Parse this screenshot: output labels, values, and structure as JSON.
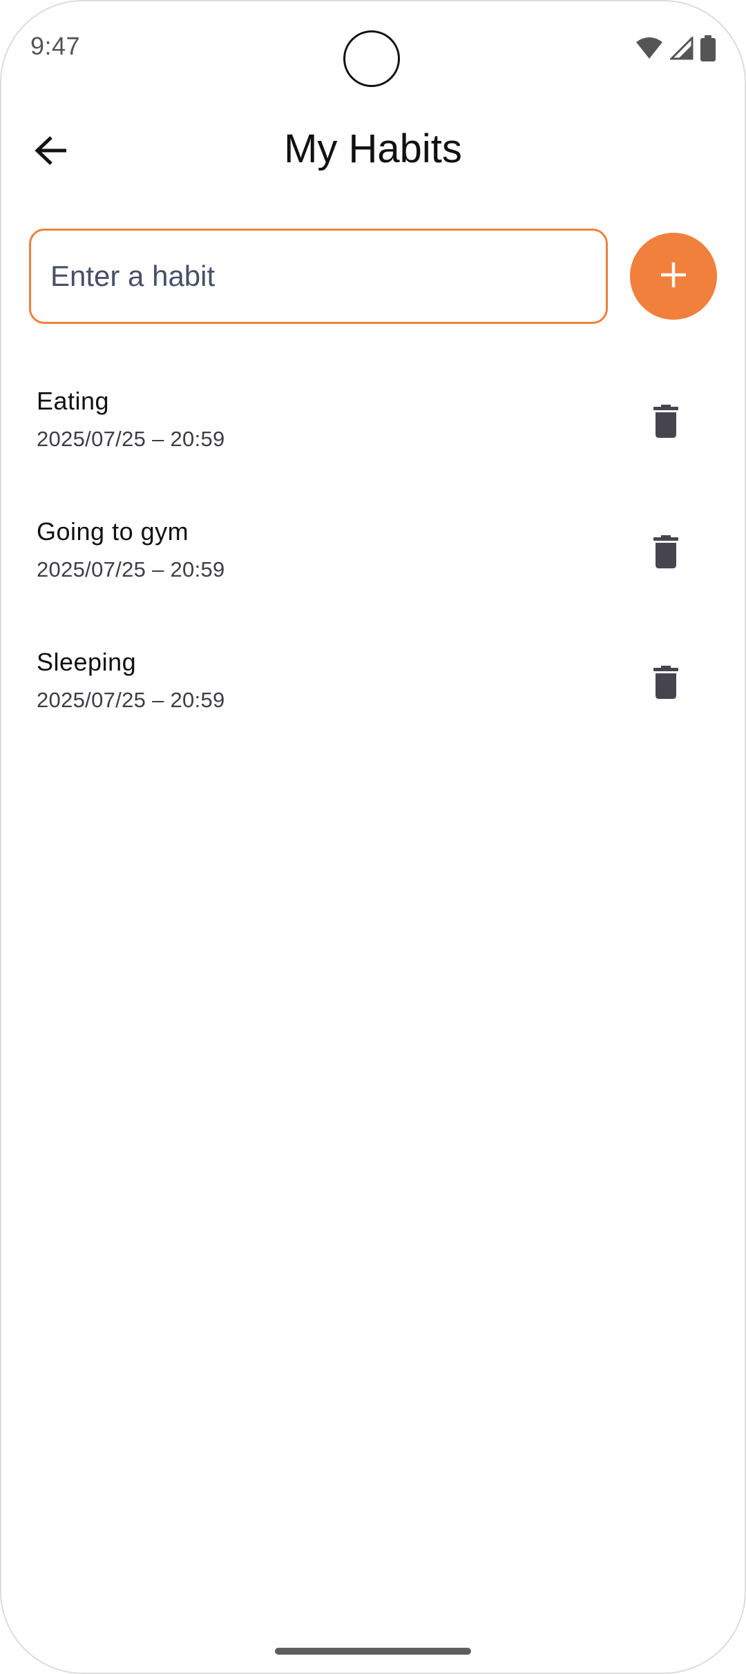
{
  "status_bar": {
    "time": "9:47",
    "icons": [
      "wifi-icon",
      "cellular-signal-icon",
      "battery-icon"
    ]
  },
  "app_bar": {
    "title": "My Habits",
    "back_icon": "arrow-back-icon"
  },
  "habit_input": {
    "placeholder": "Enter a habit",
    "value": ""
  },
  "add_button": {
    "icon": "plus-icon"
  },
  "habits": [
    {
      "name": "Eating",
      "date": "2025/07/25 – 20:59"
    },
    {
      "name": "Going to gym",
      "date": "2025/07/25 – 20:59"
    },
    {
      "name": "Sleeping",
      "date": "2025/07/25 – 20:59"
    }
  ],
  "colors": {
    "accent": "#f0803c",
    "icon_dark": "#46454f",
    "text_primary": "#111111",
    "text_secondary": "#3d3d44",
    "placeholder": "#465066"
  }
}
